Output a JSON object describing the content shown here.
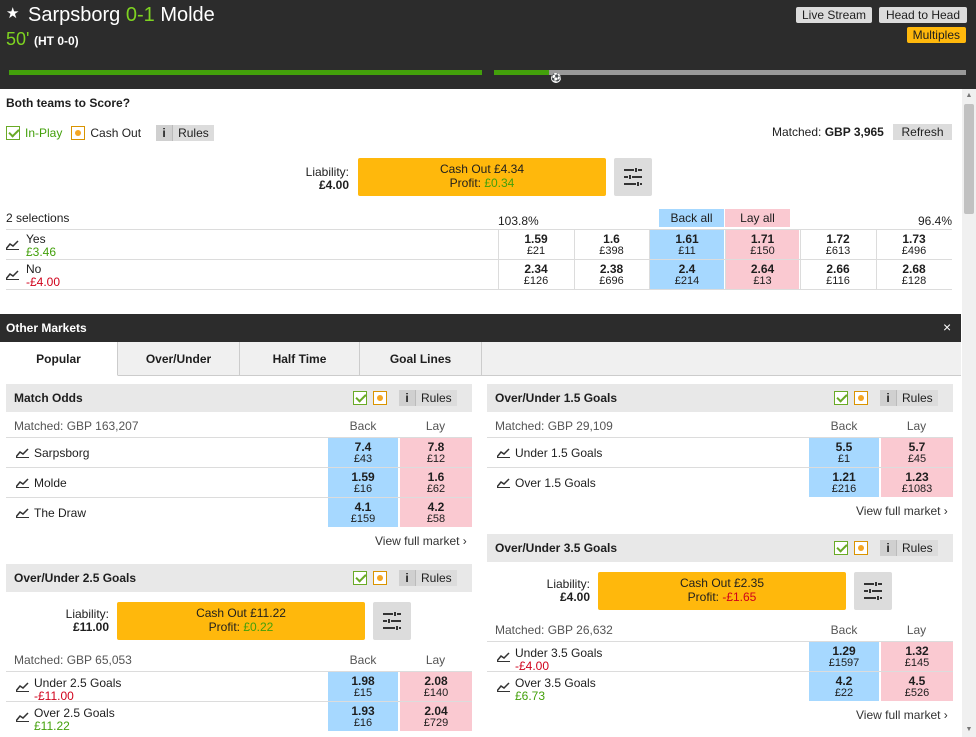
{
  "header": {
    "home": "Sarpsborg",
    "score": "0-1",
    "away": "Molde",
    "minute": "50'",
    "ht": "(HT 0-0)",
    "live_stream": "Live Stream",
    "head_to_head": "Head to Head",
    "multiples": "Multiples",
    "colors": {
      "accent": "#ffb80c",
      "green": "#7ed321",
      "header_bg": "#2c2c2c"
    }
  },
  "btts": {
    "title": "Both teams to Score?",
    "inplay": "In-Play",
    "cashout": "Cash Out",
    "info": "i",
    "rules": "Rules",
    "matched_label": "Matched:",
    "matched_value": "GBP 3,965",
    "refresh": "Refresh",
    "liability_label": "Liability:",
    "liability_value": "£4.00",
    "cashout_btn": "Cash Out £4.34",
    "profit_label": "Profit:",
    "profit_value": "£0.34",
    "selections": "2 selections",
    "back_pct": "103.8%",
    "lay_pct": "96.4%",
    "back_all": "Back all",
    "lay_all": "Lay all",
    "rows": [
      {
        "name": "Yes",
        "pnl": "£3.46",
        "prices": [
          [
            "1.59",
            "£21"
          ],
          [
            "1.6",
            "£398"
          ],
          [
            "1.61",
            "£11"
          ],
          [
            "1.71",
            "£150"
          ],
          [
            "1.72",
            "£613"
          ],
          [
            "1.73",
            "£496"
          ]
        ]
      },
      {
        "name": "No",
        "pnl": "-£4.00",
        "prices": [
          [
            "2.34",
            "£126"
          ],
          [
            "2.38",
            "£696"
          ],
          [
            "2.4",
            "£214"
          ],
          [
            "2.64",
            "£13"
          ],
          [
            "2.66",
            "£116"
          ],
          [
            "2.68",
            "£128"
          ]
        ]
      }
    ]
  },
  "other": {
    "title": "Other Markets",
    "close": "×",
    "tabs": [
      "Popular",
      "Over/Under",
      "Half Time",
      "Goal Lines"
    ]
  },
  "labels": {
    "back": "Back",
    "lay": "Lay",
    "view_full": "View full market ›",
    "i": "i",
    "rules": "Rules",
    "liability": "Liability:",
    "profit": "Profit:"
  },
  "match_odds": {
    "title": "Match Odds",
    "matched": "Matched: GBP 163,207",
    "rows": [
      {
        "name": "Sarpsborg",
        "back": [
          "7.4",
          "£43"
        ],
        "lay": [
          "7.8",
          "£12"
        ]
      },
      {
        "name": "Molde",
        "back": [
          "1.59",
          "£16"
        ],
        "lay": [
          "1.6",
          "£62"
        ]
      },
      {
        "name": "The Draw",
        "back": [
          "4.1",
          "£159"
        ],
        "lay": [
          "4.2",
          "£58"
        ]
      }
    ]
  },
  "ou25": {
    "title": "Over/Under 2.5 Goals",
    "liability": "£11.00",
    "cashout_btn": "Cash Out £11.22",
    "profit": "£0.22",
    "matched": "Matched: GBP 65,053",
    "rows": [
      {
        "name": "Under 2.5 Goals",
        "pnl": "-£11.00",
        "back": [
          "1.98",
          "£15"
        ],
        "lay": [
          "2.08",
          "£140"
        ]
      },
      {
        "name": "Over 2.5 Goals",
        "pnl": "£11.22",
        "back": [
          "1.93",
          "£16"
        ],
        "lay": [
          "2.04",
          "£729"
        ]
      }
    ]
  },
  "ou15": {
    "title": "Over/Under 1.5 Goals",
    "matched": "Matched: GBP 29,109",
    "rows": [
      {
        "name": "Under 1.5 Goals",
        "back": [
          "5.5",
          "£1"
        ],
        "lay": [
          "5.7",
          "£45"
        ]
      },
      {
        "name": "Over 1.5 Goals",
        "back": [
          "1.21",
          "£216"
        ],
        "lay": [
          "1.23",
          "£1083"
        ]
      }
    ]
  },
  "ou35": {
    "title": "Over/Under 3.5 Goals",
    "liability": "£4.00",
    "cashout_btn": "Cash Out £2.35",
    "profit": "-£1.65",
    "matched": "Matched: GBP 26,632",
    "rows": [
      {
        "name": "Under 3.5 Goals",
        "pnl": "-£4.00",
        "back": [
          "1.29",
          "£1597"
        ],
        "lay": [
          "1.32",
          "£145"
        ]
      },
      {
        "name": "Over 3.5 Goals",
        "pnl": "£6.73",
        "back": [
          "4.2",
          "£22"
        ],
        "lay": [
          "4.5",
          "£526"
        ]
      }
    ]
  }
}
